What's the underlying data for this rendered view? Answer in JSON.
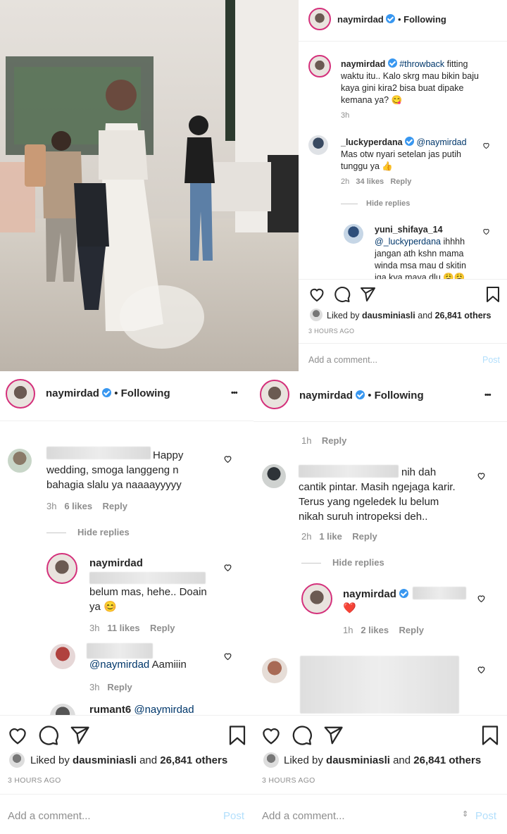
{
  "username": "naymirdad",
  "following": "Following",
  "more": "•••",
  "caption": {
    "tag": "#throwback",
    "text1": " fitting",
    "text2": "waktu itu.. Kalo skrg mau bikin baju",
    "text3": "kaya gini kira2 bisa buat dipake",
    "text4": "kemana ya? 😋",
    "time": "3h"
  },
  "c1": {
    "user": "_luckyperdana",
    "mention": "@naymirdad",
    "text1": "Mas otw nyari setelan jas putih",
    "text2": "tunggu ya 👍",
    "time": "2h",
    "likes": "34 likes",
    "reply": "Reply"
  },
  "hide_replies": "Hide replies",
  "c1r1": {
    "user": "yuni_shifaya_14",
    "mention": "@_luckyperdana",
    "text1": " ihhhh",
    "text2": "jangan ath kshn mama",
    "text3": "winda msa mau d skitin",
    "text4": "jga kya maya dlu 😩😩"
  },
  "liked_by_prefix": "Liked by ",
  "liked_by_user": "dausminiasli",
  "liked_by_mid": " and ",
  "liked_by_count": "26,841 others",
  "posted": "3 HOURS AGO",
  "add_comment": "Add a comment...",
  "post": "Post",
  "left": {
    "c1_text1": "Happy",
    "c1_text2": "wedding, smoga langgeng n",
    "c1_text3": "bahagia slalu ya naaaayyyyy",
    "c1_time": "3h",
    "c1_likes": "6 likes",
    "r1_text1": "belum mas, hehe.. Doain",
    "r1_text2": "ya 😊",
    "r1_time": "3h",
    "r1_likes": "11 likes",
    "r2_mention": "@naymirdad",
    "r2_text": " Aamiiin",
    "r2_time": "3h",
    "r3_user": "rumant6",
    "r3_mention": "@naymirdad"
  },
  "right": {
    "top_time": "1h",
    "c1_text1": "nih dah",
    "c1_text2": "cantik pintar. Masih ngejaga karir.",
    "c1_text3": "Terus yang ngeledek lu belum",
    "c1_text4": "nikah suruh intropeksi deh..",
    "c1_time": "2h",
    "c1_likes": "1 like",
    "r1_text": "❤️",
    "r1_time": "1h",
    "r1_likes": "2 likes"
  },
  "reply": "Reply"
}
